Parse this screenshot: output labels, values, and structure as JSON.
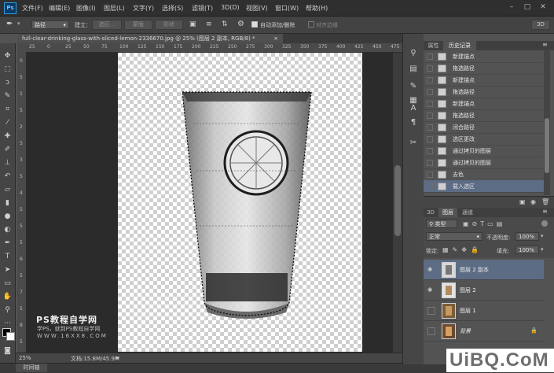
{
  "app": {
    "logo": "Ps"
  },
  "menu": [
    "文件(F)",
    "编辑(E)",
    "图像(I)",
    "图层(L)",
    "文字(Y)",
    "选择(S)",
    "滤镜(T)",
    "3D(D)",
    "视图(V)",
    "窗口(W)",
    "帮助(H)"
  ],
  "window_controls": {
    "min": "–",
    "max": "□",
    "close": "✕"
  },
  "options": {
    "mode": "路径",
    "build_label": "建立：",
    "selection_btn": "选区...",
    "mask_btn": "蒙版",
    "shape_btn": "形状",
    "auto_add": "自动添加/删除",
    "align_edges": "对齐边缘",
    "workspace": "3D"
  },
  "document": {
    "tab_title": "full-clear-drinking-glass-with-sliced-lemon-2336670.jpg @ 25% (图层 2 副本, RGB/8) *",
    "close": "×",
    "zoom": "25%",
    "doc_size": "文档:15.8M/45.9M"
  },
  "ruler_h": [
    "25",
    "0",
    "25",
    "50",
    "75",
    "100",
    "125",
    "150",
    "175",
    "200",
    "225",
    "250",
    "275",
    "300",
    "325",
    "350",
    "375",
    "400",
    "425",
    "450",
    "475"
  ],
  "ruler_v": [
    "0",
    "5",
    "1",
    "5",
    "2",
    "5",
    "3",
    "5",
    "4",
    "5",
    "5",
    "5",
    "6",
    "5",
    "7",
    "5",
    "8",
    "5"
  ],
  "watermark": {
    "line1": "PS教程自学网",
    "line2": "学PS，就到PS教程自学网",
    "line3": "WWW.16XX8.COM"
  },
  "history": {
    "tabs": [
      "属性",
      "历史记录"
    ],
    "items": [
      {
        "label": "新建锚点"
      },
      {
        "label": "拖选路径"
      },
      {
        "label": "新建锚点"
      },
      {
        "label": "拖选路径"
      },
      {
        "label": "新建锚点"
      },
      {
        "label": "拖选路径"
      },
      {
        "label": "闭合路径"
      },
      {
        "label": "选区更改"
      },
      {
        "label": "通过拷贝的图层"
      },
      {
        "label": "通过拷贝的图层"
      },
      {
        "label": "去色"
      },
      {
        "label": "载入选区"
      }
    ],
    "selected_index": 11
  },
  "layers": {
    "tabs": [
      "3D",
      "图层",
      "通道"
    ],
    "filter": "类型",
    "blend": "正常",
    "opacity_label": "不透明度:",
    "opacity": "100%",
    "lock_label": "锁定:",
    "fill_label": "填充:",
    "fill": "100%",
    "items": [
      {
        "name": "图层 2 副本",
        "visible": true,
        "locked": false
      },
      {
        "name": "图层 2",
        "visible": true,
        "locked": false
      },
      {
        "name": "图层 1",
        "visible": false,
        "locked": false
      },
      {
        "name": "背景",
        "visible": false,
        "locked": true
      }
    ],
    "selected_index": 0
  },
  "bottom_tab": "时间轴",
  "site_logo": "UiBQ.CoM",
  "colors": {
    "selection": "#5c6c85",
    "panel": "#535353",
    "dark": "#2b2b2b"
  }
}
